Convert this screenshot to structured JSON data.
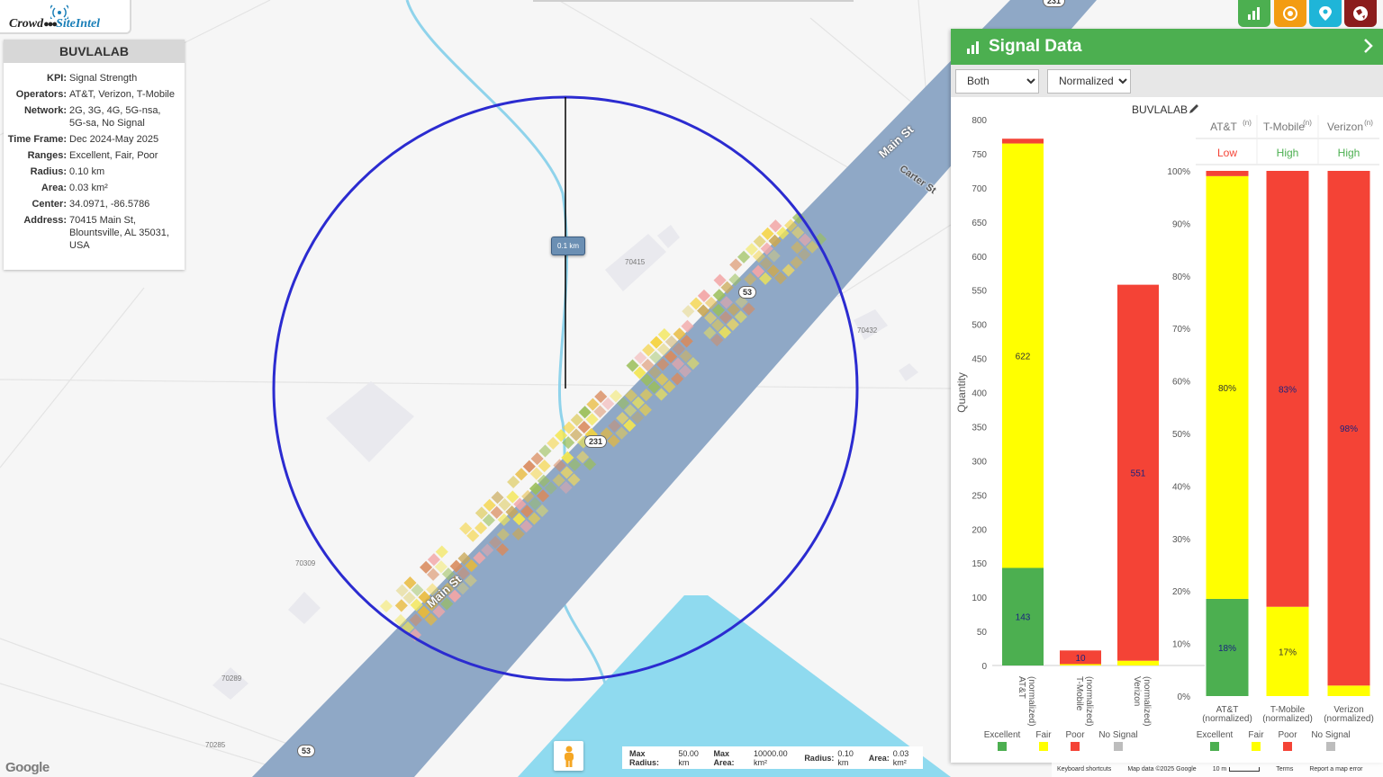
{
  "app": {
    "logo_text_a": "Crowd",
    "logo_text_b": "SiteIntel"
  },
  "info": {
    "title": "BUVLALAB",
    "rows": [
      {
        "k": "KPI:",
        "v": "Signal Strength"
      },
      {
        "k": "Operators:",
        "v": "AT&T, Verizon, T-Mobile"
      },
      {
        "k": "Network:",
        "v": "2G, 3G, 4G, 5G-nsa, 5G-sa, No Signal"
      },
      {
        "k": "Time Frame:",
        "v": "Dec 2024-May 2025"
      },
      {
        "k": "Ranges:",
        "v": "Excellent, Fair, Poor"
      },
      {
        "k": "Radius:",
        "v": "0.10 km"
      },
      {
        "k": "Area:",
        "v": "0.03 km²"
      },
      {
        "k": "Center:",
        "v": "34.0971, -86.5786"
      },
      {
        "k": "Address:",
        "v": "70415 Main St, Blountsville, AL 35031, USA"
      }
    ]
  },
  "top_buttons": [
    {
      "name": "chart-toggle-button",
      "icon": "bar-chart-icon",
      "color": "#4caf50"
    },
    {
      "name": "target-button",
      "icon": "target-icon",
      "color": "#f39c12"
    },
    {
      "name": "location-button",
      "icon": "pin-icon",
      "color": "#1fb5d8"
    },
    {
      "name": "globe-button",
      "icon": "globe-icon",
      "color": "#8b1c1c"
    }
  ],
  "map": {
    "scale_tag": "0.1 km",
    "labels": {
      "a": "70415",
      "b": "70432",
      "c": "70309",
      "d": "70289",
      "e": "70285"
    },
    "roads": {
      "main1": "Main St",
      "main2": "Main St",
      "carter": "Carter St"
    },
    "shields": {
      "s1": "53",
      "s2": "231",
      "s3": "53",
      "s4": "231"
    }
  },
  "panel": {
    "title": "Signal Data",
    "operator_select": {
      "value": "Both",
      "options": [
        "Both"
      ]
    },
    "mode_select": {
      "value": "Normalized",
      "options": [
        "Normalized"
      ]
    },
    "chart_title": "BUVLALAB"
  },
  "chart_data": [
    {
      "type": "bar",
      "stacked": true,
      "title": "BUVLALAB",
      "ylabel": "Quantity",
      "ylim": [
        0,
        800
      ],
      "yticks": [
        0,
        50,
        100,
        150,
        200,
        250,
        300,
        350,
        400,
        450,
        500,
        550,
        600,
        650,
        700,
        750,
        800
      ],
      "categories": [
        "AT&T (normalized)",
        "T-Mobile (normalized)",
        "Verizon (normalized)"
      ],
      "series": [
        {
          "name": "Excellent",
          "color": "#4caf50",
          "values": [
            143,
            0,
            0
          ]
        },
        {
          "name": "Fair",
          "color": "#ffff00",
          "values": [
            622,
            2,
            7
          ]
        },
        {
          "name": "Poor",
          "color": "#f44336",
          "values": [
            7,
            20,
            551
          ]
        },
        {
          "name": "No Signal",
          "color": "#bdbdbd",
          "values": [
            0,
            0,
            0
          ]
        }
      ],
      "data_labels": [
        {
          "category": 0,
          "series": 0,
          "text": "143"
        },
        {
          "category": 0,
          "series": 1,
          "text": "622"
        },
        {
          "category": 1,
          "series": 2,
          "text": "10"
        },
        {
          "category": 2,
          "series": 2,
          "text": "551"
        }
      ],
      "legend": "bottom"
    },
    {
      "type": "bar",
      "stacked": true,
      "ylim": [
        0,
        100
      ],
      "yticks": [
        "0%",
        "10%",
        "20%",
        "30%",
        "40%",
        "50%",
        "60%",
        "70%",
        "80%",
        "90%",
        "100%"
      ],
      "header": [
        {
          "operator": "AT&T",
          "sup": "(n)",
          "rating": "Low",
          "rating_color": "#f44336"
        },
        {
          "operator": "T-Mobile",
          "sup": "(n)",
          "rating": "High",
          "rating_color": "#4caf50"
        },
        {
          "operator": "Verizon",
          "sup": "(n)",
          "rating": "High",
          "rating_color": "#4caf50"
        }
      ],
      "categories": [
        "AT&T (normalized)",
        "T-Mobile (normalized)",
        "Verizon (normalized)"
      ],
      "series": [
        {
          "name": "Excellent",
          "color": "#4caf50",
          "values": [
            18.5,
            0,
            0
          ]
        },
        {
          "name": "Fair",
          "color": "#ffff00",
          "values": [
            80.5,
            17,
            2
          ]
        },
        {
          "name": "Poor",
          "color": "#f44336",
          "values": [
            1,
            83,
            98
          ]
        },
        {
          "name": "No Signal",
          "color": "#bdbdbd",
          "values": [
            0,
            0,
            0
          ]
        }
      ],
      "data_labels": [
        {
          "category": 0,
          "series": 0,
          "text": "18%"
        },
        {
          "category": 0,
          "series": 1,
          "text": "80%"
        },
        {
          "category": 1,
          "series": 1,
          "text": "17%"
        },
        {
          "category": 1,
          "series": 2,
          "text": "83%"
        },
        {
          "category": 2,
          "series": 2,
          "text": "98%"
        }
      ],
      "legend": "bottom"
    }
  ],
  "legend": [
    "Excellent",
    "Fair",
    "Poor",
    "No Signal"
  ],
  "stats": {
    "max_radius_k": "Max Radius:",
    "max_radius_v": "50.00 km",
    "max_area_k": "Max Area:",
    "max_area_v": "10000.00 km²",
    "radius_k": "Radius:",
    "radius_v": "0.10 km",
    "area_k": "Area:",
    "area_v": "0.03 km²"
  },
  "attribution": {
    "google": "Google",
    "shortcuts": "Keyboard shortcuts",
    "map_data": "Map data ©2025 Google",
    "scale": "10 m",
    "terms": "Terms",
    "report": "Report a map error"
  }
}
